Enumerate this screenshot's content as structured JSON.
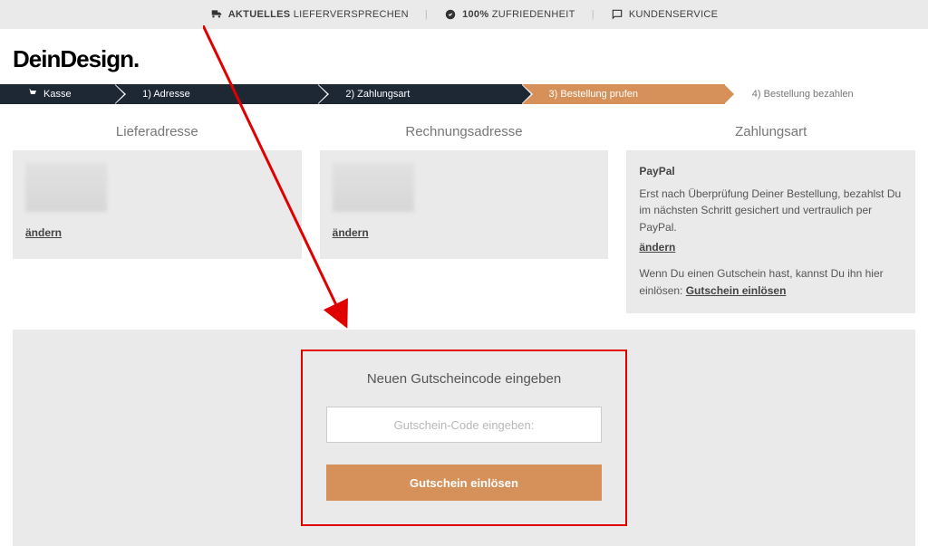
{
  "topbar": {
    "item1_bold": "AKTUELLES",
    "item1_rest": "LIEFERVERSPRECHEN",
    "item2_bold": "100%",
    "item2_rest": "ZUFRIEDENHEIT",
    "item3": "KUNDENSERVICE"
  },
  "logo": "DeinDesign.",
  "steps": {
    "s0": "Kasse",
    "s1": "1) Adresse",
    "s2": "2) Zahlungsart",
    "s3": "3) Bestellung prufen",
    "s4": "4) Bestellung bezahlen"
  },
  "col1": {
    "title": "Lieferadresse",
    "change": "ändern"
  },
  "col2": {
    "title": "Rechnungsadresse",
    "change": "ändern"
  },
  "col3": {
    "title": "Zahlungsart",
    "method": "PayPal",
    "desc": "Erst nach Überprüfung Deiner Bestellung, bezahlst Du im nächsten Schritt gesichert und vertraulich per PayPal.",
    "change": "ändern",
    "hint_pre": "Wenn Du einen Gutschein hast, kannst Du ihn hier einlösen: ",
    "hint_link": "Gutschein einlösen"
  },
  "coupon": {
    "title": "Neuen Gutscheincode eingeben",
    "placeholder": "Gutschein-Code eingeben:",
    "button": "Gutschein einlösen"
  }
}
